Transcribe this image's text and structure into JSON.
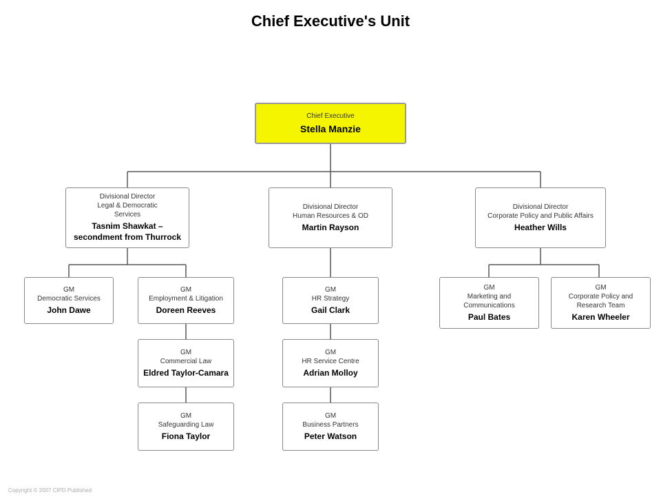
{
  "title": "Chief Executive's Unit",
  "nodes": {
    "root": {
      "role": "Chief Executive",
      "name": "Stella Manzie"
    },
    "div1": {
      "role": "Divisional Director\nLegal & Democratic\nServices",
      "name": "Tasnim Shawkat – secondment from Thurrock"
    },
    "div2": {
      "role": "Divisional Director\nHuman Resources & OD",
      "name": "Martin Rayson"
    },
    "div3": {
      "role": "Divisional Director\nCorporate Policy and Public Affairs",
      "name": "Heather Wills"
    },
    "gm1": {
      "role": "GM\nDemocratic Services",
      "name": "John Dawe"
    },
    "gm2": {
      "role": "GM\nEmployment & Litigation",
      "name": "Doreen Reeves"
    },
    "gm3": {
      "role": "GM\nHR Strategy",
      "name": "Gail Clark"
    },
    "gm4": {
      "role": "GM\nMarketing and\nCommunications",
      "name": "Paul Bates"
    },
    "gm5": {
      "role": "GM\nCorporate Policy and\nResearch Team",
      "name": "Karen Wheeler"
    },
    "gm6": {
      "role": "GM\nCommercial Law",
      "name": "Eldred Taylor-Camara"
    },
    "gm7": {
      "role": "GM\nHR Service Centre",
      "name": "Adrian Molloy"
    },
    "gm8": {
      "role": "GM\nSafeguarding Law",
      "name": "Fiona Taylor"
    },
    "gm9": {
      "role": "GM\nBusiness Partners",
      "name": "Peter Watson"
    }
  },
  "footer": "Copyright © 2007 CIPD Published"
}
